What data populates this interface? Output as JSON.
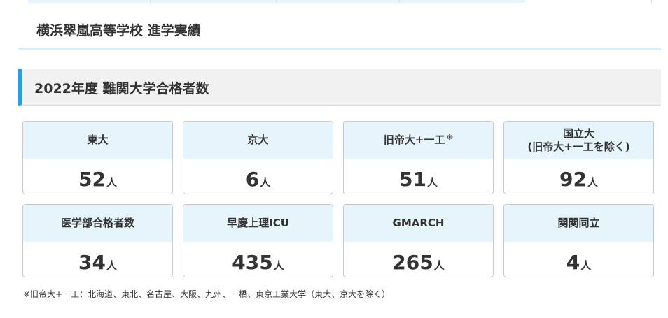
{
  "school_title": "横浜翠嵐高等学校 進学実績",
  "section_title": "2022年度 難関大学合格者数",
  "cards": [
    {
      "label": "東大",
      "note": "",
      "value": "52",
      "unit": "人"
    },
    {
      "label": "京大",
      "note": "",
      "value": "6",
      "unit": "人"
    },
    {
      "label": "旧帝大+一工",
      "note": "※",
      "value": "51",
      "unit": "人"
    },
    {
      "label": "国立大\n(旧帝大+一工を除く)",
      "note": "",
      "value": "92",
      "unit": "人"
    },
    {
      "label": "医学部合格者数",
      "note": "",
      "value": "34",
      "unit": "人"
    },
    {
      "label": "早慶上理ICU",
      "note": "",
      "value": "435",
      "unit": "人"
    },
    {
      "label": "GMARCH",
      "note": "",
      "value": "265",
      "unit": "人"
    },
    {
      "label": "関関同立",
      "note": "",
      "value": "4",
      "unit": "人"
    }
  ],
  "footnote": "※旧帝大+一工：北海道、東北、名古屋、大阪、九州、一橋、東京工業大学（東大、京大を除く）",
  "colors": {
    "accent": "#1ea1e6",
    "card_head_bg": "#e6f4fc",
    "section_bg": "#f1f1f1"
  }
}
